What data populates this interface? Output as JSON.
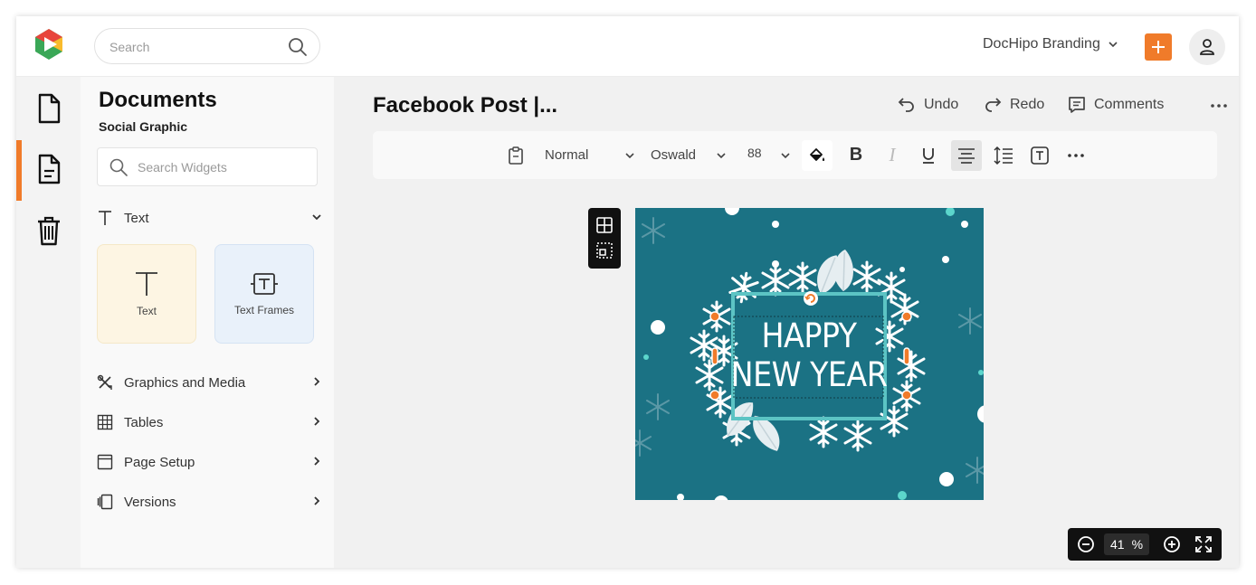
{
  "header": {
    "search_placeholder": "Search",
    "brand": "DocHipo Branding",
    "add_icon": "plus-icon",
    "profile_icon": "user-icon",
    "accent_color": "#f07b2a"
  },
  "rail": {
    "items": [
      {
        "icon": "document-icon"
      },
      {
        "icon": "document-lines-icon",
        "active": true
      },
      {
        "icon": "trash-icon"
      }
    ]
  },
  "panel": {
    "title": "Documents",
    "subtitle": "Social Graphic",
    "search_placeholder": "Search Widgets",
    "text_section": "Text",
    "cards": [
      {
        "label": "Text",
        "bg": "#fdf5e3"
      },
      {
        "label": "Text Frames",
        "bg": "#e9f1fa"
      }
    ],
    "sections": [
      "Graphics and Media",
      "Tables",
      "Page Setup",
      "Versions"
    ]
  },
  "editor": {
    "title": "Facebook Post |...",
    "undo": "Undo",
    "redo": "Redo",
    "comments": "Comments"
  },
  "toolbar": {
    "style": "Normal",
    "font": "Oswald",
    "size": "88"
  },
  "artboard": {
    "line1": "HAPPY",
    "line2": "NEW YEAR",
    "bg": "#1b7284",
    "frame_color": "#5cc4c4",
    "handle_color": "#f07b2a"
  },
  "zoom": {
    "value": "41",
    "unit": "%"
  }
}
